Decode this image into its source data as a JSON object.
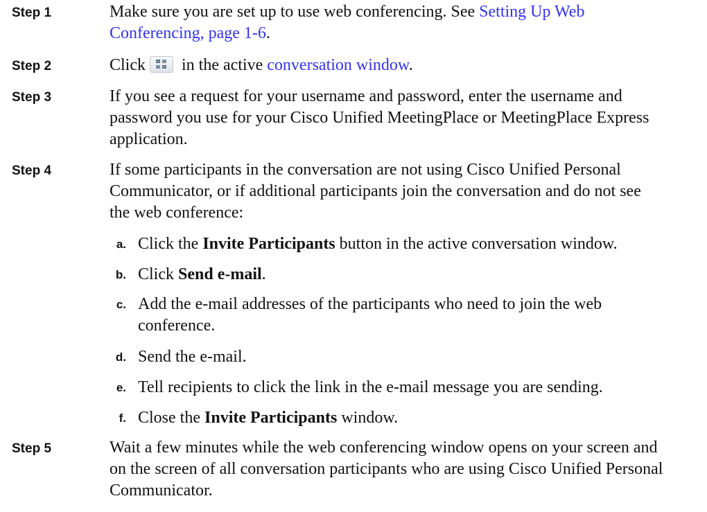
{
  "steps": [
    {
      "label": "Step 1",
      "text_1": "Make sure you are set up to use web conferencing. See ",
      "link": "Setting Up Web Conferencing, page 1-6",
      "text_2": "."
    },
    {
      "label": "Step 2",
      "text_1": "Click",
      "icon": "web-conference-icon",
      "text_2": " in the active ",
      "link": "conversation window",
      "text_3": "."
    },
    {
      "label": "Step 3",
      "text": "If you see a request for your username and password, enter the username and password you use for your Cisco Unified MeetingPlace or MeetingPlace Express application."
    },
    {
      "label": "Step 4",
      "text": "If some participants in the conversation are not using Cisco Unified Personal Communicator, or if additional participants join the conversation and do not see the web conference:",
      "substeps": [
        {
          "label": "a.",
          "text_1": "Click the ",
          "bold": "Invite Participants",
          "text_2": " button in the active conversation window."
        },
        {
          "label": "b.",
          "text_1": "Click ",
          "bold": "Send e-mail",
          "text_2": "."
        },
        {
          "label": "c.",
          "text": "Add the e-mail addresses of the participants who need to join the web conference."
        },
        {
          "label": "d.",
          "text": "Send the e-mail."
        },
        {
          "label": "e.",
          "text": "Tell recipients to click the link in the e-mail message you are sending."
        },
        {
          "label": "f.",
          "text_1": "Close the ",
          "bold": "Invite Participants",
          "text_2": " window."
        }
      ]
    },
    {
      "label": "Step 5",
      "text": "Wait a few minutes while the web conferencing window opens on your screen and on the screen of all conversation participants who are using Cisco Unified Personal Communicator."
    }
  ],
  "colors": {
    "text": "#111111",
    "link": "#3333ee"
  }
}
